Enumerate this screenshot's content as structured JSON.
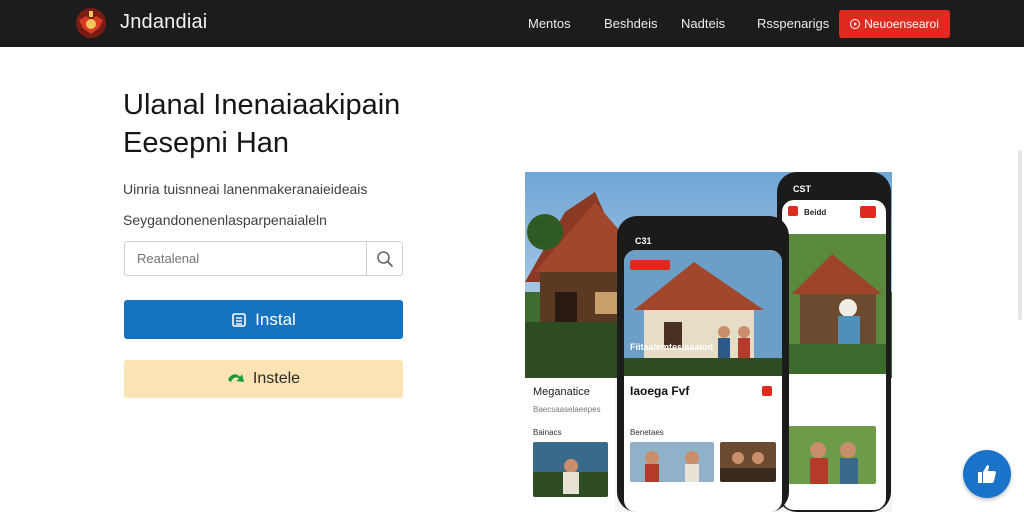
{
  "header": {
    "brand": "Jndandiai",
    "nav": [
      "Mentos",
      "Beshdeis",
      "Nadteis",
      "Rsspenarigs"
    ],
    "cta_label": "Neuoensearoi"
  },
  "hero": {
    "title_line1": "Ulanal Inenaiaakipain",
    "title_line2": "Eesepni Han",
    "subtitle_line1": "Uinria tuisnneai lanenmakeranaieideais",
    "subtitle_line2": "Seygandonenenlasparpenaialeln",
    "search_placeholder": "Reatalenal",
    "primary_button": "Instal",
    "secondary_button": "Instele"
  },
  "showcase": {
    "left_panel": {
      "title": "Meganatice",
      "caption": "Baecsaaselaeepes",
      "section": "Bainacs"
    },
    "phone_center": {
      "time": "C31",
      "headline": "Iaoega Fvf",
      "photo_caption": "Fiitaalemtesiaaalod",
      "section": "Benetaes"
    },
    "phone_right": {
      "time": "CST",
      "badge": "Beidd"
    }
  },
  "colors": {
    "topbar": "#1c1c1c",
    "accent_red": "#e02a1f",
    "primary_blue": "#1673c0",
    "secondary_cream": "#fbe3b3"
  }
}
